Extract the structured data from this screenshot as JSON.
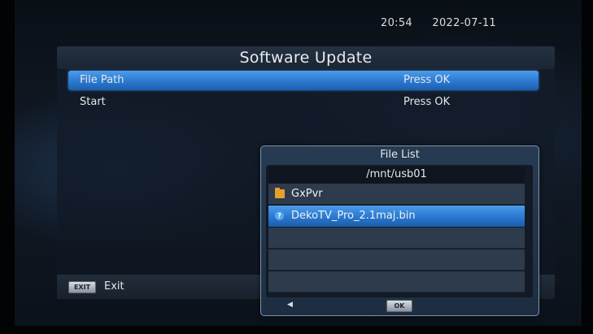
{
  "clock": {
    "time": "20:54",
    "date": "2022-07-11"
  },
  "title": "Software Update",
  "menu": [
    {
      "label": "File Path",
      "value": "Press OK",
      "selected": true
    },
    {
      "label": "Start",
      "value": "Press OK",
      "selected": false
    }
  ],
  "footer": {
    "exit_key": "EXIT",
    "exit_label": "Exit"
  },
  "file_list": {
    "title": "File List",
    "path": "/mnt/usb01",
    "items": [
      {
        "name": "GxPvr",
        "icon": "folder-icon",
        "selected": false
      },
      {
        "name": "DekoTV_Pro_2.1maj.bin",
        "icon": "file-icon",
        "selected": true
      }
    ],
    "ok_key": "OK",
    "scroll_glyph": "◀"
  },
  "colors": {
    "highlight": "#2f7fd6",
    "folder": "#e6a02a"
  }
}
